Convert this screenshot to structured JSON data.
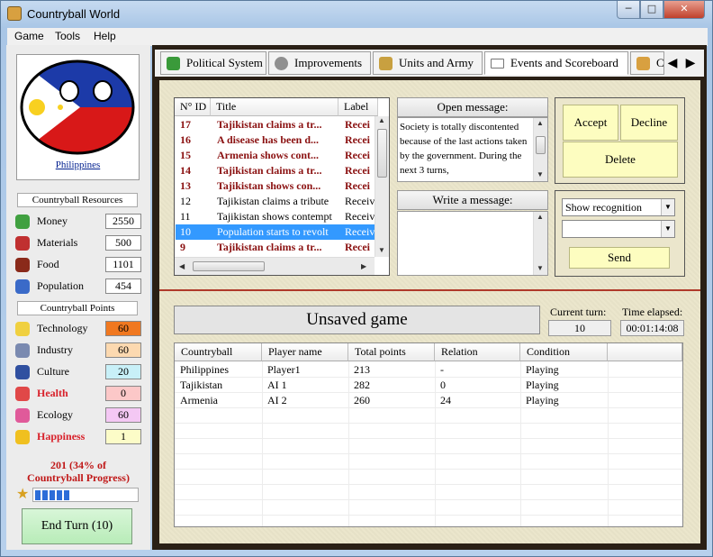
{
  "window": {
    "title": "Countryball World",
    "min": "─",
    "max": "□",
    "close": "✕"
  },
  "menu": [
    "Game",
    "Tools",
    "Help"
  ],
  "sidebar": {
    "country_name": "Philippines",
    "resources_header": "Countryball Resources",
    "resources": [
      {
        "label": "Money",
        "value": "2550",
        "icon": "money-icon",
        "color": "#40a040"
      },
      {
        "label": "Materials",
        "value": "500",
        "icon": "materials-icon",
        "color": "#c03030"
      },
      {
        "label": "Food",
        "value": "1101",
        "icon": "meat-icon",
        "color": "#8a2a1a"
      },
      {
        "label": "Population",
        "value": "454",
        "icon": "person-icon",
        "color": "#3a6ac8"
      }
    ],
    "points_header": "Countryball Points",
    "points": [
      {
        "label": "Technology",
        "value": "60",
        "bg": "#f07820",
        "icon": "lightbulb-icon",
        "color": "#f0d040",
        "red": false
      },
      {
        "label": "Industry",
        "value": "60",
        "bg": "#fcd9b0",
        "icon": "wrench-icon",
        "color": "#7a8ab0",
        "red": false
      },
      {
        "label": "Culture",
        "value": "20",
        "bg": "#c8f0f8",
        "icon": "book-icon",
        "color": "#3050a0",
        "red": false
      },
      {
        "label": "Health",
        "value": "0",
        "bg": "#fcc8c8",
        "icon": "heart-icon",
        "color": "#e04848",
        "red": true
      },
      {
        "label": "Ecology",
        "value": "60",
        "bg": "#f4c8f4",
        "icon": "rainbow-icon",
        "color": "#e05a9a",
        "red": false
      },
      {
        "label": "Happiness",
        "value": "1",
        "bg": "#fcfcc8",
        "icon": "smiley-icon",
        "color": "#f0c020",
        "red": true
      }
    ],
    "progress_line1": "201 (34% of",
    "progress_line2": "Countryball Progress)",
    "progress_fraction": 0.34,
    "end_turn": "End Turn (10)"
  },
  "tabs": [
    {
      "label": "Political System",
      "icon": "chart-icon",
      "color": "#3a9a3a"
    },
    {
      "label": "Improvements",
      "icon": "gears-icon",
      "color": "#909090"
    },
    {
      "label": "Units and Army",
      "icon": "soldier-icon",
      "color": "#c8a040"
    },
    {
      "label": "Events and Scoreboard",
      "icon": "envelope-icon",
      "color": "#d0d0d0"
    },
    {
      "label": "C",
      "icon": "graph-icon",
      "color": "#d8a040"
    }
  ],
  "messages": {
    "headers": [
      "N° ID",
      "Title",
      "Label"
    ],
    "rows": [
      {
        "id": "17",
        "title": "Tajikistan claims a tr...",
        "label": "Recei",
        "bold": true,
        "sel": false
      },
      {
        "id": "16",
        "title": "A disease has been d...",
        "label": "Recei",
        "bold": true,
        "sel": false
      },
      {
        "id": "15",
        "title": "Armenia shows cont...",
        "label": "Recei",
        "bold": true,
        "sel": false
      },
      {
        "id": "14",
        "title": "Tajikistan claims a tr...",
        "label": "Recei",
        "bold": true,
        "sel": false
      },
      {
        "id": "13",
        "title": "Tajikistan shows con...",
        "label": "Recei",
        "bold": true,
        "sel": false
      },
      {
        "id": "12",
        "title": "Tajikistan claims a tribute",
        "label": "Receiv",
        "bold": false,
        "sel": false
      },
      {
        "id": "11",
        "title": "Tajikistan shows contempt",
        "label": "Receiv",
        "bold": false,
        "sel": false
      },
      {
        "id": "10",
        "title": "Population starts to revolt",
        "label": "Receiv",
        "bold": false,
        "sel": true
      },
      {
        "id": "9",
        "title": "Tajikistan claims a tr...",
        "label": "Recei",
        "bold": true,
        "sel": false
      }
    ]
  },
  "open_message": {
    "label": "Open message:",
    "text": "Society is totally discontented because of the last actions taken by the government. During the next 3 turns,"
  },
  "write_message": {
    "label": "Write a message:"
  },
  "actions": {
    "accept": "Accept",
    "decline": "Decline",
    "delete": "Delete"
  },
  "send": {
    "combo1": "Show recognition",
    "combo2": "",
    "button": "Send"
  },
  "status": {
    "game_title": "Unsaved game",
    "turn_label": "Current turn:",
    "turn_value": "10",
    "elapsed_label": "Time elapsed:",
    "elapsed_value": "00:01:14:08"
  },
  "scoreboard": {
    "headers": [
      "Countryball",
      "Player name",
      "Total points",
      "Relation",
      "Condition"
    ],
    "rows": [
      [
        "Philippines",
        "Player1",
        "213",
        "-",
        "Playing"
      ],
      [
        "Tajikistan",
        "AI 1",
        "282",
        "0",
        "Playing"
      ],
      [
        "Armenia",
        "AI 2",
        "260",
        "24",
        "Playing"
      ]
    ]
  }
}
